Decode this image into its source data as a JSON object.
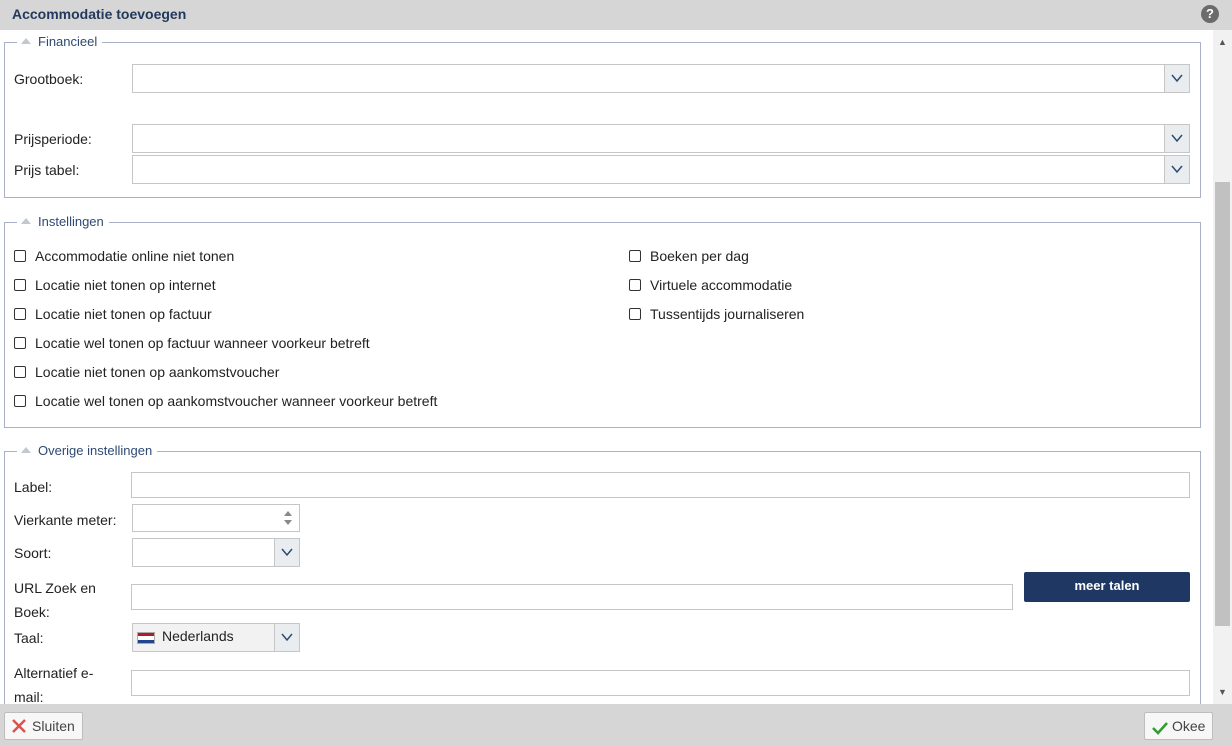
{
  "dialog": {
    "title": "Accommodatie toevoegen",
    "help_symbol": "?"
  },
  "financieel": {
    "legend": "Financieel",
    "grootboek_label": "Grootboek:",
    "grootboek_value": "",
    "prijsperiode_label": "Prijsperiode:",
    "prijsperiode_value": "",
    "prijs_tabel_label": "Prijs tabel:",
    "prijs_tabel_value": ""
  },
  "instellingen": {
    "legend": "Instellingen",
    "left": [
      {
        "label": "Accommodatie online niet tonen",
        "checked": false
      },
      {
        "label": "Locatie niet tonen op internet",
        "checked": false
      },
      {
        "label": "Locatie niet tonen op factuur",
        "checked": false
      },
      {
        "label": "Locatie wel tonen op factuur wanneer voorkeur betreft",
        "checked": false
      },
      {
        "label": "Locatie niet tonen op aankomstvoucher",
        "checked": false
      },
      {
        "label": "Locatie wel tonen op aankomstvoucher wanneer voorkeur betreft",
        "checked": false
      }
    ],
    "right": [
      {
        "label": "Boeken per dag",
        "checked": false
      },
      {
        "label": "Virtuele accommodatie",
        "checked": false
      },
      {
        "label": "Tussentijds journaliseren",
        "checked": false
      }
    ]
  },
  "overige": {
    "legend": "Overige instellingen",
    "label_label": "Label:",
    "label_value": "",
    "vierkante_meter_label": "Vierkante meter:",
    "vierkante_meter_value": "",
    "soort_label": "Soort:",
    "soort_value": "",
    "url_label_line1": "URL Zoek en",
    "url_label_line2": "Boek:",
    "url_value": "",
    "meer_talen_button": "meer talen",
    "taal_label": "Taal:",
    "taal_value": "Nederlands",
    "alt_email_label_line1": "Alternatief e-",
    "alt_email_label_line2": "mail:",
    "alt_email_value": ""
  },
  "footer": {
    "close_button": "Sluiten",
    "ok_button": "Okee"
  },
  "colors": {
    "title": "#22395d",
    "primary_button": "#1f3863",
    "chrome": "#d6d6d6",
    "fieldset_border": "#a8b1c7",
    "ok_check": "#2e9e2e",
    "close_x": "#d9534f"
  },
  "icons": {
    "help": "help-icon",
    "dropdown": "chevron-down-icon",
    "collapse": "collapse-triangle-icon",
    "flag": "netherlands-flag-icon",
    "close": "close-x-icon",
    "ok": "checkmark-icon",
    "spinner": "spinner-arrows-icon"
  }
}
